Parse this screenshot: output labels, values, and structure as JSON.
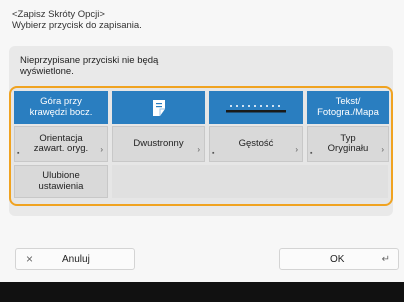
{
  "header": {
    "title": "<Zapisz Skróty Opcji>",
    "instruction": "Wybierz przycisk do zapisania."
  },
  "notice": {
    "line1": "Nieprzypisane przyciski nie będą",
    "line2": "wyświetlone."
  },
  "tiles": {
    "gora_line1": "Góra przy",
    "gora_line2": "krawędzi bocz.",
    "tekst_line1": "Tekst/",
    "tekst_line2": "Fotogra./Mapa",
    "orientacja_line1": "Orientacja",
    "orientacja_line2": "zawart. oryg.",
    "dwustronny": "Dwustronny",
    "gestosc": "Gęstość",
    "typ_line1": "Typ",
    "typ_line2": "Oryginału",
    "ulubione_line1": "Ulubione",
    "ulubione_line2": "ustawienia"
  },
  "buttons": {
    "cancel": "Anuluj",
    "ok": "OK"
  },
  "colors": {
    "accent_orange": "#f0a321",
    "tile_blue": "#2a7ec0",
    "bottom_bar": "#111111"
  }
}
